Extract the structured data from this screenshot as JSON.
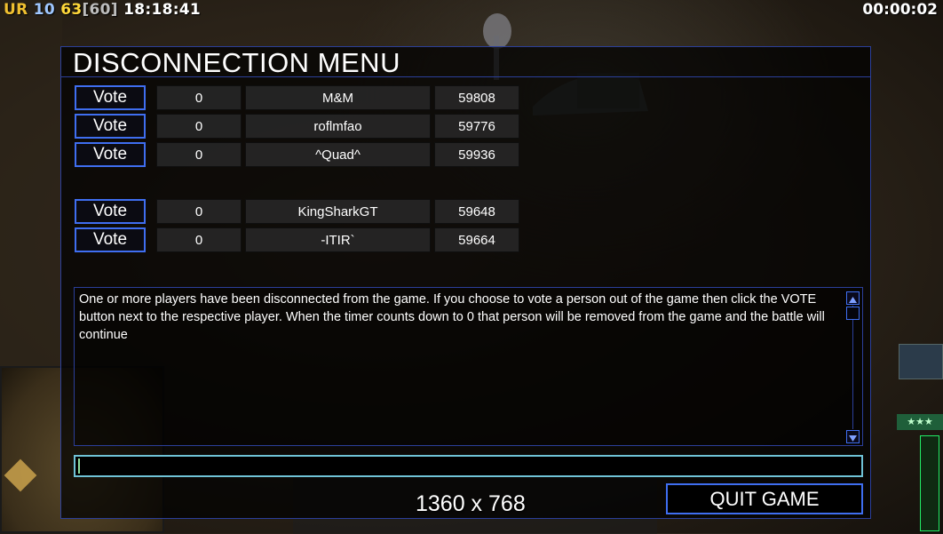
{
  "hud": {
    "faction": "UR",
    "value_a": "10",
    "fps": "63",
    "fps_cap": "[60]",
    "clock": "18:18:41",
    "elapsed": "00:00:02"
  },
  "dialog": {
    "title": "DISCONNECTION MENU",
    "players": [
      {
        "vote_label": "Vote",
        "count": "0",
        "name": "M&M",
        "ping": "59808"
      },
      {
        "vote_label": "Vote",
        "count": "0",
        "name": "roflmfao",
        "ping": "59776"
      },
      {
        "vote_label": "Vote",
        "count": "0",
        "name": "^Quad^",
        "ping": "59936"
      },
      {
        "vote_label": "Vote",
        "count": "0",
        "name": "KingSharkGT",
        "ping": "59648"
      },
      {
        "vote_label": "Vote",
        "count": "0",
        "name": "-ITIR`",
        "ping": "59664"
      }
    ],
    "message": "One or more players have been disconnected from the game. If you choose to vote a person out of the game then click the VOTE button next to the respective player. When the timer counts down to 0 that person will be removed from the game and the battle will continue",
    "chat_value": "",
    "quit_label": "QUIT GAME"
  },
  "overlay": {
    "resolution": "1360 x 768"
  },
  "colors": {
    "border_blue": "#3f6ef0",
    "panel_border": "#2b3f9a",
    "input_border": "#6fc2d6"
  }
}
